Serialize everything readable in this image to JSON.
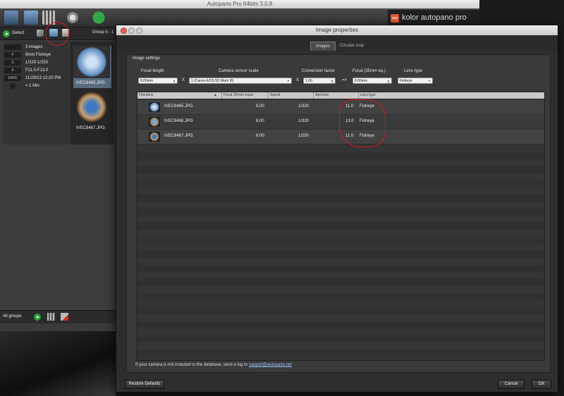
{
  "main_window": {
    "title": "Autopano Pro 64bits 3.0.8",
    "brand": "kolor autopano pro",
    "brand_mark": "app",
    "detect_label": "Detect",
    "group_label": "Group 0 - 1",
    "info": [
      {
        "key": "",
        "value": "3 images"
      },
      {
        "key": "F",
        "value": "8mm Fisheye"
      },
      {
        "key": "S",
        "value": "1/320-1/250"
      },
      {
        "key": "A",
        "value": "F11.0-F13.0"
      },
      {
        "key": "DATE",
        "value": "11/29/13 12:20 PM"
      },
      {
        "key": "",
        "value": "< 1 Min"
      }
    ],
    "thumbnails": [
      {
        "label": "IVEC8465.JPG"
      },
      {
        "label": "IVEC8467.JPG"
      }
    ],
    "all_groups_label": "All groups"
  },
  "dialog": {
    "title": "Image properties",
    "tabs": [
      "Images",
      "Circular crop"
    ],
    "settings_title": "Image settings",
    "fields": {
      "focal_length_label": "Focal length",
      "focal_length_value": "8.00mm",
      "sensor_label": "Camera sensor scale",
      "sensor_value": "1 (Canon-EOS 5D Mark III)",
      "conversion_label": "Conversion factor",
      "conversion_value": "1.00",
      "focal35_label": "Focal (35mm eq.)",
      "focal35_value": "8.00mm",
      "lens_label": "Lens type",
      "lens_value": "Fisheye",
      "x1": "X",
      "x2": "X",
      "arrow": "=>"
    },
    "table": {
      "headers": [
        "Filename",
        "Focal (35mm equiv",
        "Speed",
        "Aperture",
        "Lens type"
      ],
      "rows": [
        {
          "filename": "IVEC8465.JPG",
          "focal": "8.00",
          "speed": "1/320",
          "aperture": "11.0",
          "lens": "Fisheye"
        },
        {
          "filename": "IVEC8466.JPG",
          "focal": "8.00",
          "speed": "1/320",
          "aperture": "13.0",
          "lens": "Fisheye"
        },
        {
          "filename": "IVEC8467.JPG",
          "focal": "8.00",
          "speed": "1/250",
          "aperture": "11.0",
          "lens": "Fisheye"
        }
      ]
    },
    "footer_note": "If your camera is not included to the database, send a log to",
    "footer_link": "support@autopano.net",
    "buttons": {
      "restore": "Restore Defaults",
      "cancel": "Cancel",
      "ok": "OK"
    }
  },
  "colors": {
    "annotation": "#e0141b",
    "accent_orange": "#e0562a",
    "play_green": "#27a33a"
  }
}
